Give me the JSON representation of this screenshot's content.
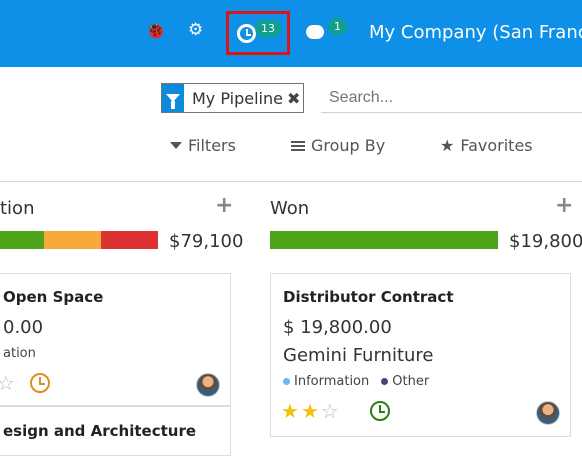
{
  "topbar": {
    "activity_count": "13",
    "chat_count": "1",
    "company": "My Company (San Franc"
  },
  "search": {
    "facet_label": "My Pipeline",
    "placeholder": "Search..."
  },
  "controls": {
    "filters": "Filters",
    "group_by": "Group By",
    "favorites": "Favorites"
  },
  "columns": [
    {
      "title": "tion",
      "amount": "$79,100",
      "progress": [
        {
          "color": "#4ea31b",
          "fraction": 0.28
        },
        {
          "color": "#f7a93b",
          "fraction": 0.36
        },
        {
          "color": "#dc3232",
          "fraction": 0.36
        }
      ],
      "cards": [
        {
          "title": "Open Space",
          "amount": "0.00",
          "tag": "ation",
          "stars": 1,
          "clock_color": "#d9931b"
        },
        {
          "title": "esign and Architecture"
        }
      ]
    },
    {
      "title": "Won",
      "amount": "$19,800",
      "progress": [
        {
          "color": "#4ea31b",
          "fraction": 1.0
        }
      ],
      "cards": [
        {
          "title": "Distributor Contract",
          "amount": "$ 19,800.00",
          "company": "Gemini Furniture",
          "tags": [
            {
              "label": "Information",
              "color": "#6cb6ea"
            },
            {
              "label": "Other",
              "color": "#3b4b6e"
            }
          ],
          "stars": 2,
          "clock_color": "#2f7d12"
        }
      ]
    }
  ]
}
